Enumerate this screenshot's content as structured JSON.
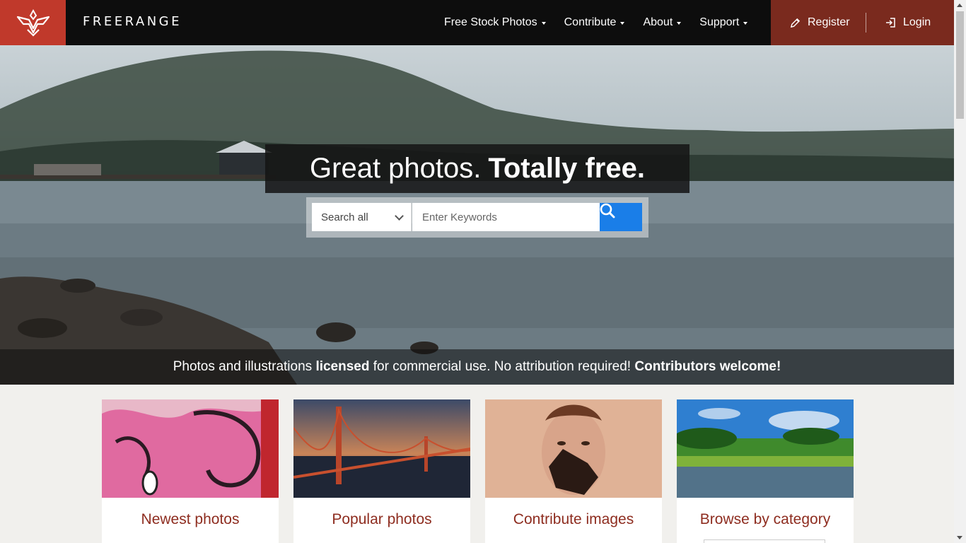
{
  "brand": {
    "name": "FREERANGE"
  },
  "nav": {
    "items": [
      {
        "label": "Free Stock Photos"
      },
      {
        "label": "Contribute"
      },
      {
        "label": "About"
      },
      {
        "label": "Support"
      }
    ],
    "register": "Register",
    "login": "Login"
  },
  "hero": {
    "headline_light": "Great photos.",
    "headline_bold": "Totally free.",
    "search": {
      "scope": "Search all",
      "placeholder": "Enter Keywords"
    },
    "tagline": {
      "part1": "Photos and illustrations ",
      "bold1": "licensed",
      "part2": " for commercial use. No attribution required! ",
      "bold2": "Contributors welcome!"
    }
  },
  "cards": [
    {
      "label": "Newest photos"
    },
    {
      "label": "Popular photos"
    },
    {
      "label": "Contribute images"
    },
    {
      "label": "Browse by category"
    }
  ],
  "colors": {
    "brand_red": "#c0392b",
    "auth_bg": "#7a2a1e",
    "search_blue": "#1a7ee8",
    "card_label": "#8e2d20"
  }
}
